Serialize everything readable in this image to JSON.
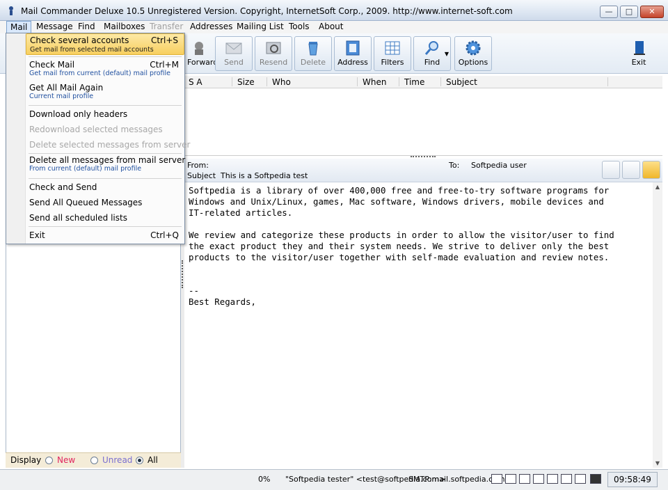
{
  "window": {
    "title": "Mail Commander Deluxe 10.5 Unregistered Version. Copyright, InternetSoft Corp., 2009. http://www.internet-soft.com",
    "min_glyph": "—",
    "max_glyph": "□",
    "close_glyph": "✕"
  },
  "menubar": [
    "Mail",
    "Message",
    "Find",
    "Mailboxes",
    "Transfer",
    "Addresses",
    "Mailing List",
    "Tools",
    "About"
  ],
  "toolbar": {
    "forward": "Forward",
    "send": "Send",
    "resend": "Resend",
    "delete": "Delete",
    "address": "Address",
    "filters": "Filters",
    "find": "Find",
    "options": "Options",
    "exit": "Exit"
  },
  "mail_menu": {
    "check_several": "Check several accounts",
    "check_several_key": "Ctrl+S",
    "check_several_sub": "Get mail from selected mail accounts",
    "check_mail": "Check Mail",
    "check_mail_key": "Ctrl+M",
    "check_mail_sub": "Get mail from current (default) mail profile",
    "get_all": "Get All Mail Again",
    "get_all_sub": "Current mail profile",
    "download_headers": "Download only headers",
    "redownload": "Redownload selected messages",
    "delete_selected_server": "Delete selected messages from server",
    "delete_all_server": "Delete all messages from mail server",
    "delete_all_server_sub": "From current (default) mail profile",
    "check_and_send": "Check and Send",
    "send_queued": "Send All Queued Messages",
    "send_scheduled": "Send all scheduled lists",
    "exit": "Exit",
    "exit_key": "Ctrl+Q"
  },
  "message_list": {
    "columns": [
      "S A",
      "Size",
      "Who",
      "When",
      "Time",
      "Subject"
    ]
  },
  "preview": {
    "from_label": "From:",
    "to_label": "To:",
    "to_value": "Softpedia user",
    "subject_label": "Subject",
    "subject_value": "This is a Softpedia test",
    "body": "Softpedia is a library of over 400,000 free and free-to-try software programs for\nWindows and Unix/Linux, games, Mac software, Windows drivers, mobile devices and\nIT-related articles.\n\nWe review and categorize these products in order to allow the visitor/user to find\nthe exact product they and their system needs. We strive to deliver only the best\nproducts to the visitor/user together with self-made evaluation and review notes.\n\n\n--\nBest Regards,"
  },
  "display_filter": {
    "label": "Display",
    "options": [
      "New",
      "Unread",
      "All"
    ],
    "selected": "All",
    "new_color": "#e0245e",
    "unread_color": "#7a6fd0"
  },
  "status": {
    "progress": "0%",
    "sender": "\"Softpedia tester\" <test@softpedia.com>",
    "smtp": "SMTP:mail.softpedia.com",
    "time": "09:58:49"
  }
}
